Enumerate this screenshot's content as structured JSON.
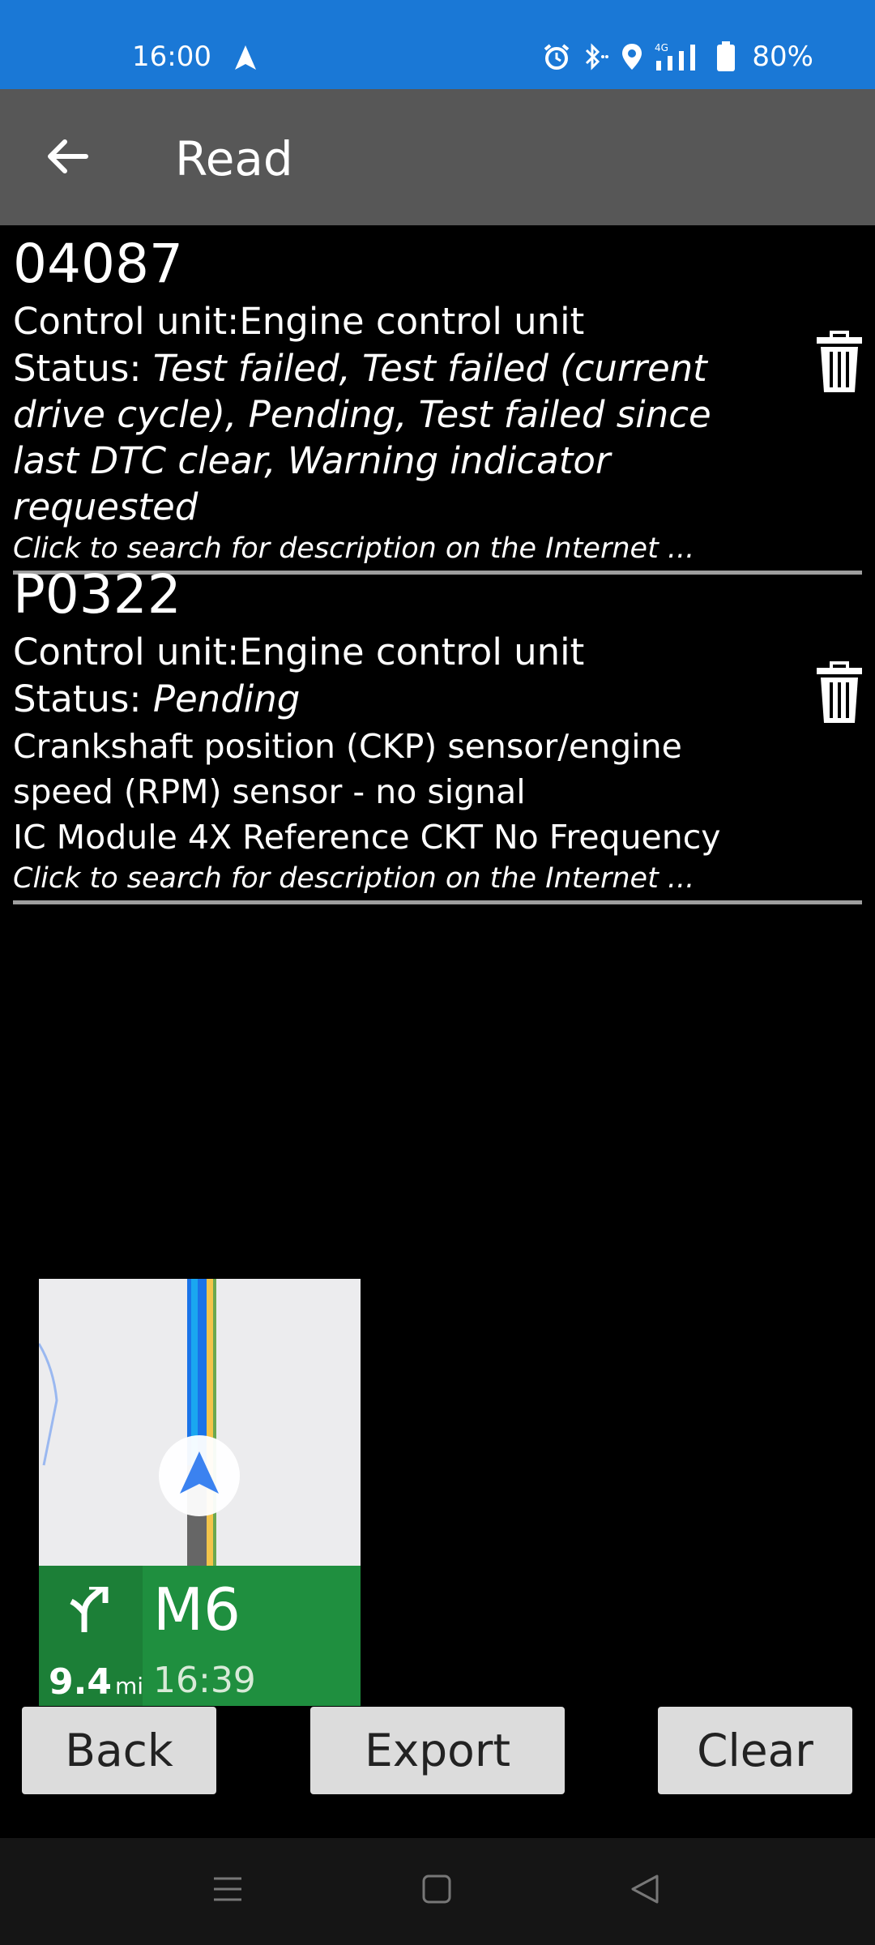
{
  "status_bar": {
    "time": "16:00",
    "battery": "80%",
    "icons": [
      "navigation-icon",
      "alarm-icon",
      "bluetooth-icon",
      "location-icon",
      "signal-4g-icon",
      "battery-icon"
    ],
    "bg_color": "#1a78d6"
  },
  "app_bar": {
    "title": "Read",
    "bg_color": "#575757"
  },
  "dtcs": [
    {
      "code": "04087",
      "unit": "Control unit:Engine control unit",
      "status_label": "Status: ",
      "status_value": "Test failed, Test failed (current drive cycle), Pending, Test failed since last DTC clear, Warning indicator requested",
      "description": [],
      "link": "Click to search for description on the Internet ..."
    },
    {
      "code": "P0322",
      "unit": "Control unit:Engine control unit",
      "status_label": "Status: ",
      "status_value": "Pending",
      "description": [
        "Crankshaft position (CKP) sensor/engine speed (RPM) sensor - no signal",
        "IC Module 4X Reference CKT No Frequency"
      ],
      "link": "Click to search for description on the Internet ..."
    }
  ],
  "map_overlay": {
    "distance": "9.4",
    "distance_unit": "mi",
    "road": "M6",
    "eta": "16:39",
    "panel_color": "#1f8f3f"
  },
  "buttons": {
    "back": "Back",
    "export": "Export",
    "clear": "Clear"
  }
}
